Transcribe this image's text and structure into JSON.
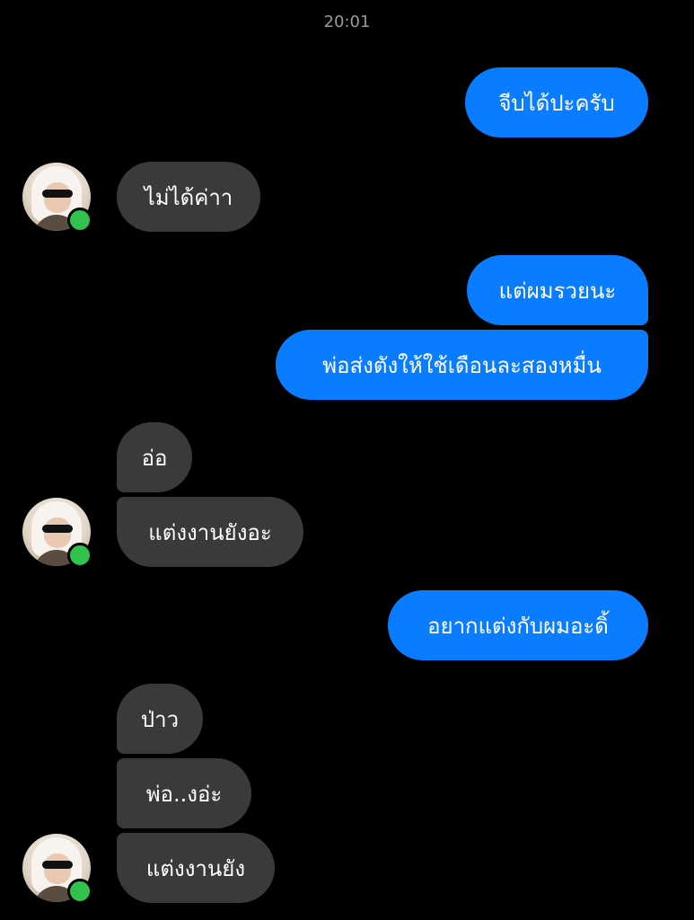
{
  "header": {
    "time": "20:01"
  },
  "messages": [
    {
      "text": "จีบได้ปะครับ"
    },
    {
      "text": "ไม่ได้ค่าา"
    },
    {
      "text": "แต่ผมรวยนะ"
    },
    {
      "text": "พ่อส่งตังให้ใช้เดือนละสองหมื่น"
    },
    {
      "text": "อ่อ"
    },
    {
      "text": "แต่งงานยังอะ"
    },
    {
      "text": "อยากแต่งกับผมอะดิ้"
    },
    {
      "text": "ป่าว"
    },
    {
      "text": "พ่อ..งอ่ะ"
    },
    {
      "text": "แต่งงานยัง"
    }
  ],
  "colors": {
    "outgoing_bubble": "#0a7cff",
    "incoming_bubble": "#3a3a3c",
    "online_dot": "#31c24d",
    "background": "#000000"
  }
}
